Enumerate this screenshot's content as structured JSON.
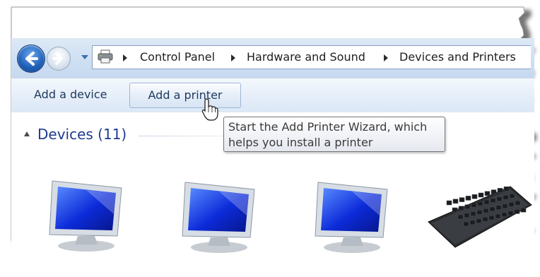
{
  "address_bar": {
    "breadcrumbs": [
      "Control Panel",
      "Hardware and Sound",
      "Devices and Printers"
    ],
    "icons": {
      "back": "back-arrow-icon",
      "forward": "forward-arrow-icon",
      "history": "chevron-down-icon",
      "location": "devices-printers-icon",
      "separator": "chevron-right-icon"
    }
  },
  "command_bar": {
    "add_device_label": "Add a device",
    "add_printer_label": "Add a printer"
  },
  "tooltip": {
    "lines": [
      "Start the Add Printer Wizard, which",
      "helps you install a printer"
    ]
  },
  "devices_group": {
    "header": "Devices (11)",
    "items": [
      {
        "icon": "monitor-icon"
      },
      {
        "icon": "monitor-icon"
      },
      {
        "icon": "monitor-icon"
      },
      {
        "icon": "keyboard-icon"
      }
    ]
  },
  "colors": {
    "link_blue": "#1e3b8e",
    "command_text": "#1e395b",
    "torn_edge_shadow": "#4a4a4a"
  }
}
